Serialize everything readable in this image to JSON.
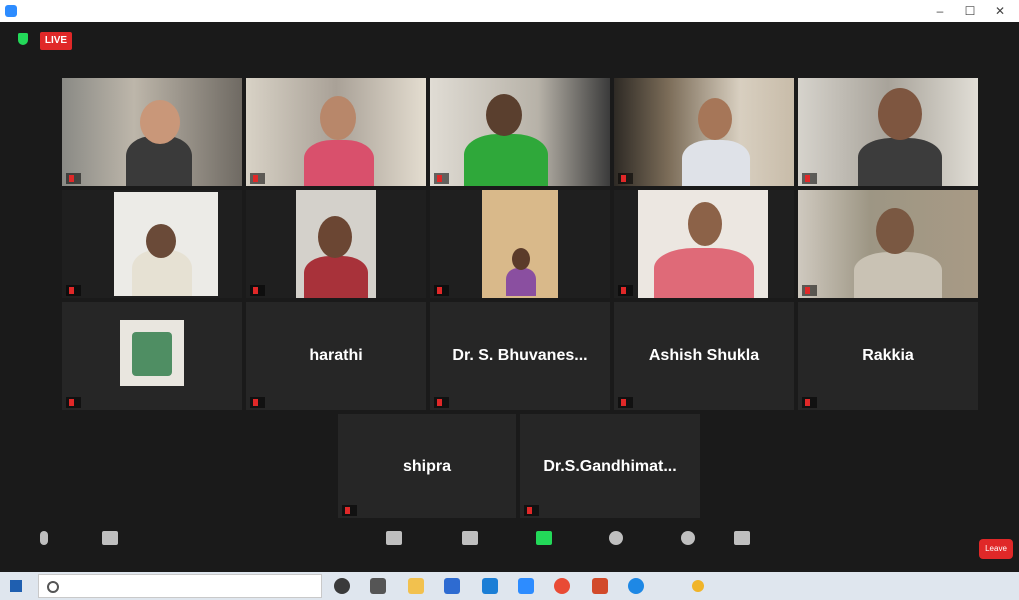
{
  "window": {
    "title": "",
    "minimize": "–",
    "maximize": "☐",
    "close": "✕"
  },
  "topbar": {
    "live_badge": "LIVE",
    "live_status": "",
    "view_button": ""
  },
  "colors": {
    "live_red": "#e02828",
    "active_speaker_border": "#c5d96a",
    "share_green": "#23d959"
  },
  "participants": [
    {
      "name": "",
      "video": true
    },
    {
      "name": "",
      "video": true
    },
    {
      "name": "",
      "video": true,
      "active": true
    },
    {
      "name": "",
      "video": true
    },
    {
      "name": "",
      "video": true
    },
    {
      "name": "",
      "video": true
    },
    {
      "name": "",
      "video": true
    },
    {
      "name": "",
      "video": true
    },
    {
      "name": "",
      "video": true
    },
    {
      "name": "",
      "video": true
    },
    {
      "name": "",
      "video": true
    },
    {
      "name": "",
      "display": "harathi",
      "video": false
    },
    {
      "name": "",
      "display": "Dr. S. Bhuvanes...",
      "video": false
    },
    {
      "name": "",
      "display": "Ashish Shukla",
      "video": false
    },
    {
      "name": "",
      "display": "Rakkia",
      "video": false
    },
    {
      "name": "",
      "display": "shipra",
      "video": false
    },
    {
      "name": "",
      "display": "Dr.S.Gandhimat...",
      "video": false
    }
  ],
  "toolbar": {
    "unmute": "",
    "start_video": "",
    "participants": "",
    "participants_count": "",
    "chat": "",
    "share_screen": "",
    "record": "",
    "reactions": "",
    "apps": "",
    "leave": "Leave"
  },
  "taskbar": {
    "search_placeholder": "",
    "temperature": "",
    "time": "",
    "date": "",
    "lang": ""
  }
}
